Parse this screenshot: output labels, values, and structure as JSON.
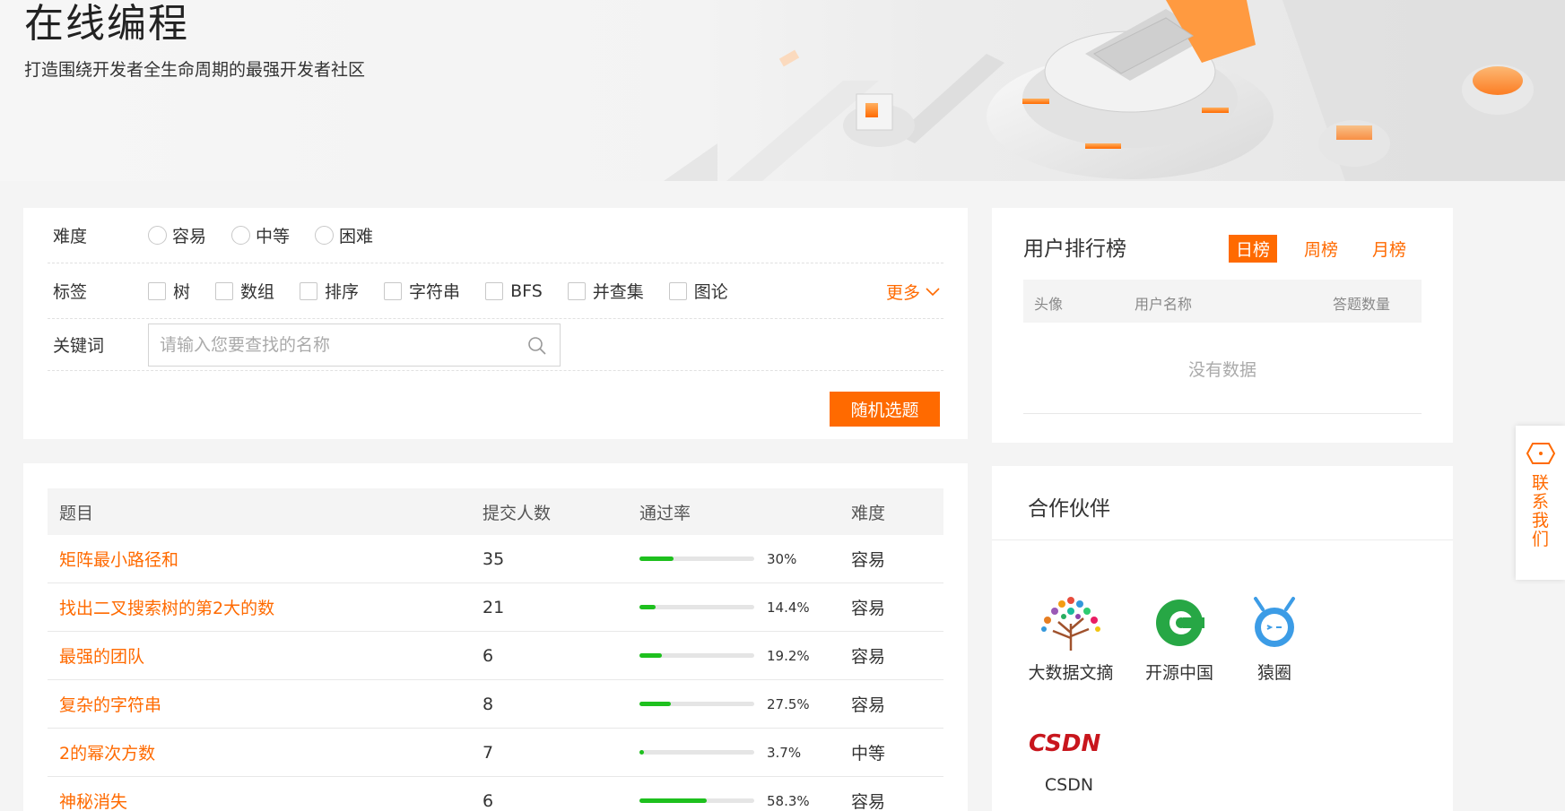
{
  "banner": {
    "title": "在线编程",
    "subtitle": "打造围绕开发者全生命周期的最强开发者社区"
  },
  "filters": {
    "difficulty": {
      "label": "难度",
      "options": [
        "容易",
        "中等",
        "困难"
      ]
    },
    "tags": {
      "label": "标签",
      "options": [
        "树",
        "数组",
        "排序",
        "字符串",
        "BFS",
        "并查集",
        "图论"
      ],
      "more_label": "更多"
    },
    "keyword": {
      "label": "关键词",
      "placeholder": "请输入您要查找的名称"
    },
    "random_button": "随机选题"
  },
  "problems": {
    "headers": [
      "题目",
      "提交人数",
      "通过率",
      "难度"
    ],
    "rows": [
      {
        "title": "矩阵最小路径和",
        "submissions": "35",
        "pass_rate": "30%",
        "pass_value": 30,
        "difficulty": "容易"
      },
      {
        "title": "找出二叉搜索树的第2大的数",
        "submissions": "21",
        "pass_rate": "14.4%",
        "pass_value": 14.4,
        "difficulty": "容易"
      },
      {
        "title": "最强的团队",
        "submissions": "6",
        "pass_rate": "19.2%",
        "pass_value": 19.2,
        "difficulty": "容易"
      },
      {
        "title": "复杂的字符串",
        "submissions": "8",
        "pass_rate": "27.5%",
        "pass_value": 27.5,
        "difficulty": "容易"
      },
      {
        "title": "2的幂次方数",
        "submissions": "7",
        "pass_rate": "3.7%",
        "pass_value": 3.7,
        "difficulty": "中等"
      },
      {
        "title": "神秘消失",
        "submissions": "6",
        "pass_rate": "58.3%",
        "pass_value": 58.3,
        "difficulty": "容易"
      }
    ]
  },
  "ranking": {
    "title": "用户排行榜",
    "tabs": [
      "日榜",
      "周榜",
      "月榜"
    ],
    "active_tab": "日榜",
    "headers": [
      "头像",
      "用户名称",
      "答题数量"
    ],
    "empty_text": "没有数据"
  },
  "partners": {
    "title": "合作伙伴",
    "items": [
      {
        "name": "大数据文摘",
        "icon": "tree-logo-icon"
      },
      {
        "name": "开源中国",
        "icon": "oschina-logo-icon"
      },
      {
        "name": "猿圈",
        "icon": "yuanquan-logo-icon"
      },
      {
        "name": "CSDN",
        "icon": "csdn-logo-icon",
        "logo_text": "CSDN"
      }
    ]
  },
  "contact": {
    "label": "联系我们",
    "icon": "chat-icon"
  },
  "colors": {
    "accent": "#ff6a00",
    "progress": "#1ec01e"
  }
}
